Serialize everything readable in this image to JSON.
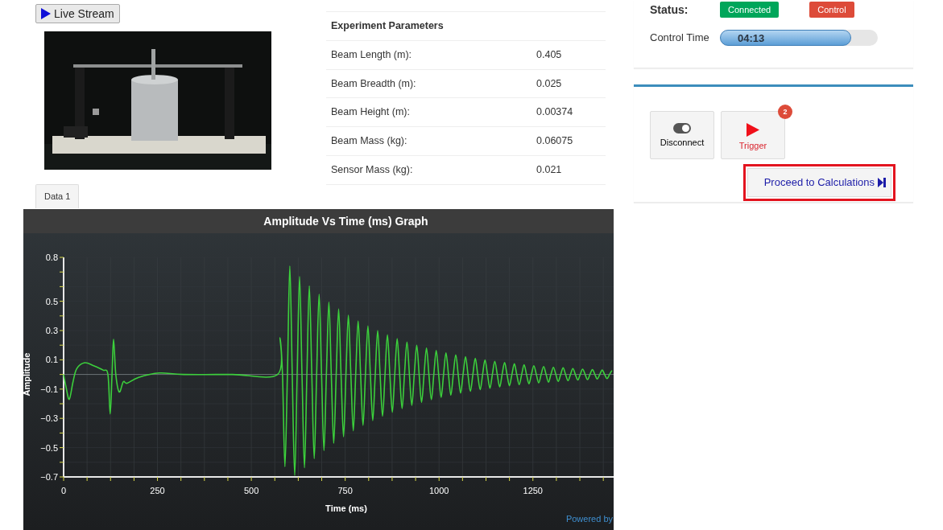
{
  "live_stream_button": {
    "label": "Live Stream"
  },
  "data_tabs": [
    {
      "label": "Data 1"
    }
  ],
  "parameters": {
    "title": "Experiment Parameters",
    "rows": [
      {
        "name": "Beam Length (m):",
        "value": "0.405"
      },
      {
        "name": "Beam Breadth (m):",
        "value": "0.025"
      },
      {
        "name": "Beam Height (m):",
        "value": "0.00374"
      },
      {
        "name": "Beam Mass (kg):",
        "value": "0.06075"
      },
      {
        "name": "Sensor Mass (kg):",
        "value": "0.021"
      }
    ]
  },
  "status": {
    "label": "Status:",
    "indicators": [
      {
        "label": "Connected",
        "color": "#00a65a"
      },
      {
        "label": "Control",
        "color": "#dd4b39"
      }
    ]
  },
  "control_time": {
    "label": "Control Time",
    "reading": "04:13",
    "level": 0.83
  },
  "actions": [
    {
      "kind": "toggle",
      "label": "Disconnect"
    },
    {
      "kind": "trigger",
      "label": "Trigger",
      "badge": "2"
    }
  ],
  "proceed_button": {
    "label": "Proceed to Calculations",
    "highlighted": true
  },
  "chart": {
    "powered_by": "Powered by",
    "chart_data": {
      "type": "line",
      "title": "Amplitude Vs Time (ms) Graph",
      "xlabel": "Time (ms)",
      "ylabel": "Amplitude",
      "xlim": [
        0,
        1465
      ],
      "ylim": [
        -0.7,
        0.8
      ],
      "grid": true,
      "xticks": [
        0,
        250,
        500,
        750,
        1000,
        1250
      ],
      "yticks": [
        0.8,
        0.5,
        0.3,
        0.1,
        -0.1,
        -0.3,
        -0.5,
        -0.7
      ],
      "x": [
        0,
        6,
        15,
        25,
        35,
        56,
        80,
        105,
        118,
        124,
        129,
        133,
        139,
        148,
        159,
        169,
        200,
        255,
        320,
        450,
        570,
        576.5,
        583,
        589.5,
        596,
        602.5,
        609,
        615.5,
        622,
        628.5,
        635,
        641.5,
        648,
        654.5,
        661,
        667.5,
        674,
        680.5,
        687,
        693.5,
        700,
        706.5,
        713,
        719.5,
        726,
        732.5,
        739,
        745.5,
        752,
        758.5,
        765,
        771.5,
        778,
        784.5,
        791,
        797.5,
        804,
        810.5,
        817,
        823.5,
        830,
        836.5,
        843,
        849.5,
        856,
        862.5,
        869,
        875.5,
        882,
        888.5,
        895,
        901.5,
        908,
        914.5,
        921,
        927.5,
        934,
        940.5,
        947,
        953.5,
        960,
        966.5,
        973,
        979.5,
        986,
        992.5,
        999,
        1005.5,
        1012,
        1018.5,
        1025,
        1031.5,
        1038,
        1044.5,
        1051,
        1057.5,
        1064,
        1070.5,
        1077,
        1083.5,
        1090,
        1096.5,
        1103,
        1109.5,
        1116,
        1122.5,
        1129,
        1135.5,
        1142,
        1148.5,
        1155,
        1161.5,
        1168,
        1174.5,
        1181,
        1187.5,
        1194,
        1200.5,
        1207,
        1213.5,
        1220,
        1226.5,
        1233,
        1239.5,
        1246,
        1252.5,
        1259,
        1265.5,
        1272,
        1278.5,
        1285,
        1291.5,
        1298,
        1304.5,
        1311,
        1317.5,
        1324,
        1330.5,
        1337,
        1343.5,
        1350,
        1356.5,
        1363,
        1369.5,
        1376,
        1382.5,
        1389,
        1395.5,
        1402,
        1408.5,
        1415,
        1421.5,
        1428,
        1434.5,
        1441,
        1447.5,
        1454,
        1460.5
      ],
      "series": [
        {
          "color": "#3ccf3c",
          "values": [
            0,
            -0.08,
            -0.17,
            -0.05,
            0.04,
            0.08,
            0.06,
            0.03,
            0,
            -0.27,
            0,
            0.24,
            0,
            -0.12,
            -0.05,
            -0.06,
            -0.02,
            0.01,
            0,
            0,
            0,
            0.25,
            0,
            -0.63,
            0,
            0.74,
            0,
            -0.69,
            0,
            0.669,
            0,
            -0.637,
            0,
            0.605,
            0,
            -0.576,
            0,
            0.548,
            0,
            -0.521,
            0,
            0.495,
            0,
            -0.471,
            0,
            0.448,
            0,
            -0.426,
            0,
            0.405,
            0,
            -0.385,
            0,
            0.366,
            0,
            -0.348,
            0,
            0.331,
            0,
            -0.315,
            0,
            0.3,
            0,
            -0.285,
            0,
            0.271,
            0,
            -0.258,
            0,
            0.245,
            0,
            -0.233,
            0,
            0.222,
            0,
            -0.211,
            0,
            0.2,
            0,
            -0.19,
            0,
            0.181,
            0,
            -0.172,
            0,
            0.164,
            0,
            -0.156,
            0,
            0.148,
            0,
            -0.141,
            0,
            0.134,
            0,
            -0.127,
            0,
            0.121,
            0,
            -0.115,
            0,
            0.11,
            0,
            -0.104,
            0,
            0.099,
            0,
            -0.094,
            0,
            0.09,
            0,
            -0.085,
            0,
            0.081,
            0,
            -0.077,
            0,
            0.073,
            0,
            -0.07,
            0,
            0.066,
            0,
            -0.063,
            0,
            0.06,
            0,
            -0.057,
            0,
            0.054,
            0,
            -0.052,
            0,
            0.049,
            0,
            -0.047,
            0,
            0.045,
            0,
            -0.042,
            0,
            0.04,
            0,
            -0.038,
            0,
            0.036,
            0,
            -0.035,
            0,
            0.033,
            0,
            -0.031,
            0,
            0.03,
            0,
            -0.028,
            0,
            0.027
          ]
        }
      ]
    }
  }
}
